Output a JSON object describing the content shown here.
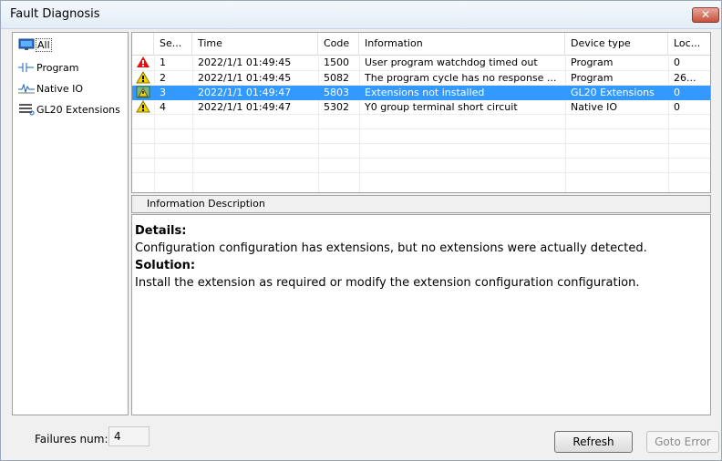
{
  "window": {
    "title": "Fault Diagnosis",
    "close_label": "✕"
  },
  "tree": {
    "items": [
      {
        "label": "All",
        "icon": "monitor-icon",
        "selected": true
      },
      {
        "label": "Program",
        "icon": "ladder-contact-icon"
      },
      {
        "label": "Native IO",
        "icon": "signal-wave-icon"
      },
      {
        "label": "GL20 Extensions",
        "icon": "extension-module-icon"
      }
    ]
  },
  "grid": {
    "columns": [
      "Se...",
      "Time",
      "Code",
      "Information",
      "Device type",
      "Loc..."
    ],
    "rows": [
      {
        "level": "error",
        "icon": "error-triangle-icon",
        "seq": "1",
        "time": "2022/1/1 01:49:45",
        "code": "1500",
        "info": "User program watchdog timed out",
        "device": "Program",
        "loc": "0",
        "selected": false
      },
      {
        "level": "warning",
        "icon": "warning-triangle-icon",
        "seq": "2",
        "time": "2022/1/1 01:49:45",
        "code": "5082",
        "info": "The program cycle has no response ...",
        "device": "Program",
        "loc": "26...",
        "selected": false
      },
      {
        "level": "info",
        "icon": "info-warning-icon",
        "seq": "3",
        "time": "2022/1/1 01:49:47",
        "code": "5803",
        "info": "Extensions not installed",
        "device": "GL20 Extensions",
        "loc": "0",
        "selected": true
      },
      {
        "level": "warning",
        "icon": "warning-triangle-icon",
        "seq": "4",
        "time": "2022/1/1 01:49:47",
        "code": "5302",
        "info": "Y0 group terminal short circuit",
        "device": "Native IO",
        "loc": "0",
        "selected": false
      }
    ]
  },
  "description": {
    "header": "Information Description",
    "details_label": "Details:",
    "details_text": "Configuration configuration has extensions, but no extensions were actually detected.",
    "solution_label": "Solution:",
    "solution_text": "Install the extension as required or modify the extension configuration configuration."
  },
  "footer": {
    "failures_label": "Failures num:",
    "failures_value": "4",
    "refresh_label": "Refresh",
    "goto_label": "Goto Error"
  },
  "colors": {
    "selection": "#3399ff",
    "error": "#e01010",
    "warning": "#f2d200"
  }
}
